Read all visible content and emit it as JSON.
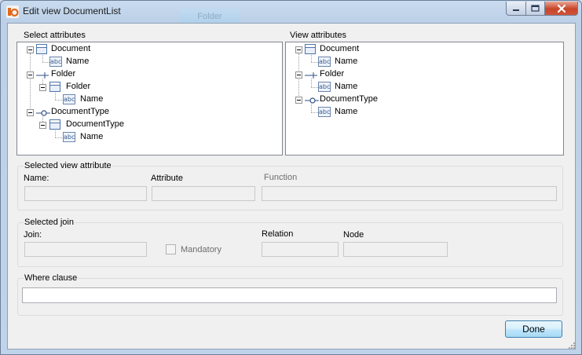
{
  "window": {
    "title": "Edit view DocumentList",
    "background_button_label": "Folder"
  },
  "select_attributes": {
    "label": "Select attributes",
    "tree": [
      {
        "text": "Document",
        "icon": "class-icon"
      },
      {
        "text": "Name",
        "icon": "abc-attribute-icon"
      },
      {
        "text": "Folder",
        "icon": "link-icon"
      },
      {
        "text": "Folder",
        "icon": "class-icon"
      },
      {
        "text": "Name",
        "icon": "abc-attribute-icon"
      },
      {
        "text": "DocumentType",
        "icon": "link-circle-icon"
      },
      {
        "text": "DocumentType",
        "icon": "class-icon"
      },
      {
        "text": "Name",
        "icon": "abc-attribute-icon"
      }
    ]
  },
  "view_attributes": {
    "label": "View attributes",
    "tree": [
      {
        "text": "Document",
        "icon": "class-icon"
      },
      {
        "text": "Name",
        "icon": "abc-attribute-icon"
      },
      {
        "text": "Folder",
        "icon": "link-icon"
      },
      {
        "text": "Name",
        "icon": "abc-attribute-icon"
      },
      {
        "text": "DocumentType",
        "icon": "link-circle-icon"
      },
      {
        "text": "Name",
        "icon": "abc-attribute-icon"
      }
    ]
  },
  "selected_view_attribute": {
    "label": "Selected view attribute",
    "name_label": "Name:",
    "attribute_label": "Attribute",
    "function_label": "Function",
    "name_value": "",
    "attribute_value": "",
    "function_value": ""
  },
  "selected_join": {
    "label": "Selected join",
    "join_label": "Join:",
    "mandatory_label": "Mandatory",
    "relation_label": "Relation",
    "node_label": "Node",
    "join_value": "",
    "relation_value": "",
    "node_value": ""
  },
  "where_clause": {
    "label": "Where clause",
    "value": ""
  },
  "done_label": "Done",
  "abc_glyph": "abc"
}
